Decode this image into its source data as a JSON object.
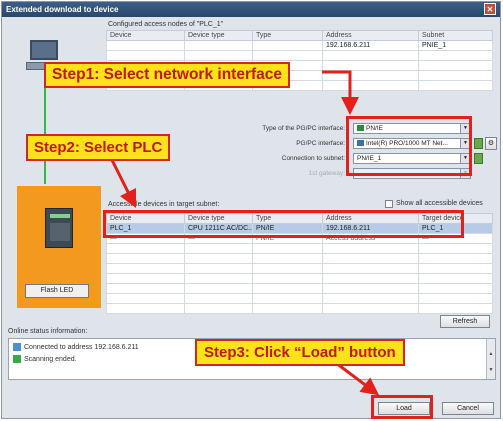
{
  "window": {
    "title": "Extended download to device",
    "close_glyph": "✕"
  },
  "configured": {
    "label": "Configured access nodes of \"PLC_1\"",
    "columns": [
      "Device",
      "Device type",
      "Type",
      "Address",
      "Subnet"
    ],
    "row": [
      "",
      "",
      "",
      "192.168.6.211",
      "PNIE_1"
    ]
  },
  "interface": {
    "type_label": "Type of the PG/PC interface:",
    "type_value": "PN/IE",
    "pgpc_label": "PG/PC interface:",
    "pgpc_value": "Intel(R) PRO/1000 MT Net...",
    "subnet_label": "Connection to subnet:",
    "subnet_value": "PN/IE_1",
    "gateway_label": "1st gateway:",
    "gateway_value": ""
  },
  "accessible": {
    "label": "Accessible devices in target subnet:",
    "show_all_label": "Show all accessible devices",
    "columns": [
      "Device",
      "Device type",
      "Type",
      "Address",
      "Target device"
    ],
    "rows": [
      [
        "PLC_1",
        "CPU 1211C AC/DC...",
        "PN/IE",
        "192.168.6.211",
        "PLC_1"
      ],
      [
        "—",
        "—",
        "PN/IE",
        "Access address",
        "—"
      ]
    ]
  },
  "buttons": {
    "flash_led": "Flash LED",
    "refresh": "Refresh",
    "load": "Load",
    "cancel": "Cancel"
  },
  "status": {
    "label": "Online status information:",
    "lines": [
      "Connected to address 192.168.6.211",
      "Scanning ended."
    ]
  },
  "callouts": {
    "step1": "Step1: Select network interface",
    "step2": "Step2: Select PLC",
    "step3": "Step3: Click “Load” button"
  },
  "colors": {
    "callout_bg": "#ffe31a",
    "callout_text": "#c31810",
    "highlight": "#e3211a",
    "plc_panel": "#f39a1e",
    "link_line": "#39b54a"
  },
  "icons": [
    "pc-icon",
    "plc-icon",
    "network-icon",
    "check-icon",
    "connect-icon",
    "close-icon"
  ]
}
